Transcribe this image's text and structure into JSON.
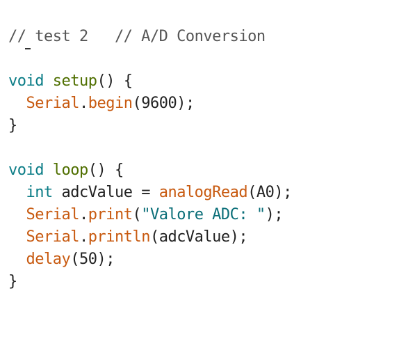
{
  "editor": {
    "lines": [
      {
        "parts": [
          {
            "t": "// test 2   // A/D Conversion",
            "k": "comment"
          }
        ]
      },
      {
        "parts": []
      },
      {
        "parts": [
          {
            "t": "void",
            "k": "type"
          },
          {
            "t": " ",
            "k": "plain"
          },
          {
            "t": "setup",
            "k": "func"
          },
          {
            "t": "() {",
            "k": "plain"
          }
        ]
      },
      {
        "parts": [
          {
            "t": "  ",
            "k": "plain"
          },
          {
            "t": "Serial",
            "k": "call"
          },
          {
            "t": ".",
            "k": "plain"
          },
          {
            "t": "begin",
            "k": "call"
          },
          {
            "t": "(9600);",
            "k": "plain"
          }
        ]
      },
      {
        "parts": [
          {
            "t": "}",
            "k": "plain"
          }
        ]
      },
      {
        "parts": []
      },
      {
        "parts": [
          {
            "t": "void",
            "k": "type"
          },
          {
            "t": " ",
            "k": "plain"
          },
          {
            "t": "loop",
            "k": "func"
          },
          {
            "t": "() {",
            "k": "plain"
          }
        ]
      },
      {
        "parts": [
          {
            "t": "  ",
            "k": "plain"
          },
          {
            "t": "int",
            "k": "type"
          },
          {
            "t": " adcValue = ",
            "k": "plain"
          },
          {
            "t": "analogRead",
            "k": "call"
          },
          {
            "t": "(A0);",
            "k": "plain"
          }
        ]
      },
      {
        "parts": [
          {
            "t": "  ",
            "k": "plain"
          },
          {
            "t": "Serial",
            "k": "call"
          },
          {
            "t": ".",
            "k": "plain"
          },
          {
            "t": "print",
            "k": "call"
          },
          {
            "t": "(",
            "k": "plain"
          },
          {
            "t": "\"Valore ADC: \"",
            "k": "str"
          },
          {
            "t": ");",
            "k": "plain"
          }
        ]
      },
      {
        "parts": [
          {
            "t": "  ",
            "k": "plain"
          },
          {
            "t": "Serial",
            "k": "call"
          },
          {
            "t": ".",
            "k": "plain"
          },
          {
            "t": "println",
            "k": "call"
          },
          {
            "t": "(adcValue);",
            "k": "plain"
          }
        ]
      },
      {
        "parts": [
          {
            "t": "  ",
            "k": "plain"
          },
          {
            "t": "delay",
            "k": "call"
          },
          {
            "t": "(50);",
            "k": "plain"
          }
        ]
      },
      {
        "parts": [
          {
            "t": "}",
            "k": "plain"
          }
        ]
      }
    ]
  },
  "colors": {
    "comment": "#555555",
    "type": "#0a7c86",
    "func": "#4f6f00",
    "call": "#c85a10",
    "plain": "#222222",
    "str": "#0a6e78"
  }
}
